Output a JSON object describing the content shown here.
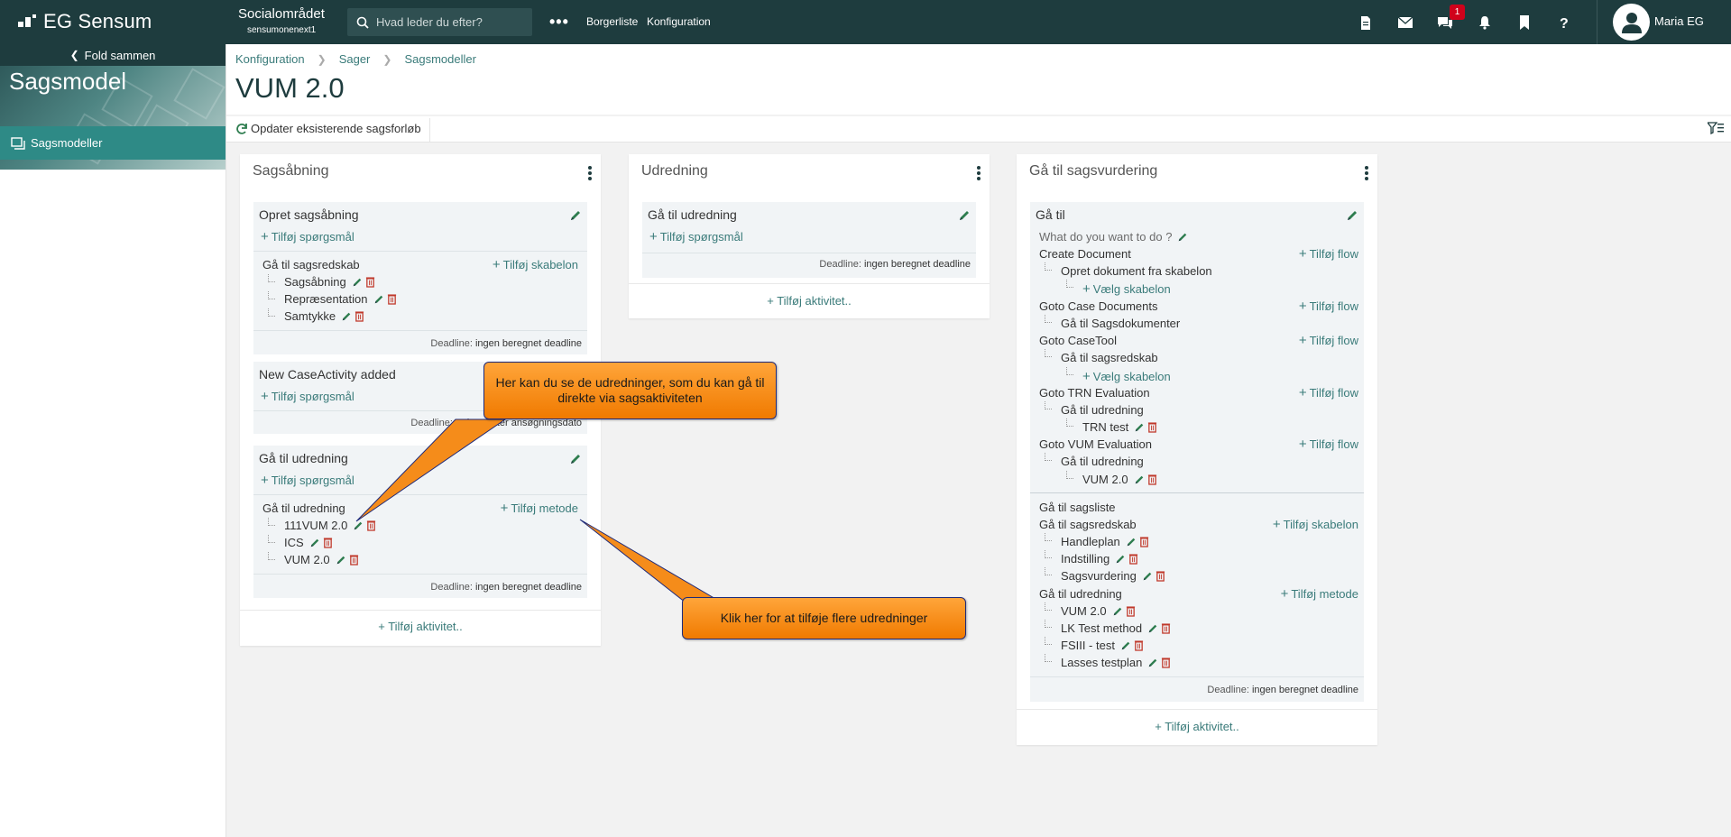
{
  "topbar": {
    "logo": "EG Sensum",
    "org_name": "Socialområdet",
    "org_sub": "sensumonenext1",
    "search_placeholder": "Hvad leder du efter?",
    "more": "•••",
    "link1": "Borgerliste",
    "link2": "Konfiguration",
    "notification_count": "1",
    "user_name": "Maria EG"
  },
  "sidebar": {
    "fold_label": "Fold sammen",
    "title": "Sagsmodel",
    "item": "Sagsmodeller"
  },
  "breadcrumb": [
    "Konfiguration",
    "Sager",
    "Sagsmodeller"
  ],
  "page_title": "VUM 2.0",
  "toolbar": {
    "update_label": "Opdater eksisterende sagsforløb"
  },
  "columns": [
    {
      "title": "Sagsåbning",
      "cards": [
        {
          "title": "Opret sagsåbning",
          "add_question": "Tilføj spørgsmål",
          "group_title": "Gå til sagsredskab",
          "group_add": "Tilføj skabelon",
          "items": [
            "Sagsåbning",
            "Repræsentation",
            "Samtykke"
          ],
          "deadline_label": "Deadline:",
          "deadline_value": "ingen beregnet deadline"
        },
        {
          "title": "New CaseActivity added",
          "add_question": "Tilføj spørgsmål",
          "deadline_label": "Deadline:",
          "deadline_value": "4 dage efter ansøgningsdato"
        },
        {
          "title": "Gå til udredning",
          "add_question": "Tilføj spørgsmål",
          "group_title": "Gå til udredning",
          "group_add": "Tilføj metode",
          "items": [
            "111VUM 2.0",
            "ICS",
            "VUM 2.0"
          ],
          "deadline_label": "Deadline:",
          "deadline_value": "ingen beregnet deadline"
        }
      ],
      "add_activity": "Tilføj aktivitet.."
    },
    {
      "title": "Udredning",
      "cards": [
        {
          "title": "Gå til udredning",
          "add_question": "Tilføj spørgsmål",
          "deadline_label": "Deadline:",
          "deadline_value": "ingen beregnet deadline"
        }
      ],
      "add_activity": "Tilføj aktivitet.."
    },
    {
      "title": "Gå til sagsvurdering",
      "card": {
        "title": "Gå til",
        "question": "What do you want to do ?",
        "flows": [
          {
            "title": "Create Document",
            "add": "Tilføj flow",
            "sub": "Opret dokument fra skabelon",
            "subsub": "Vælg skabelon"
          },
          {
            "title": "Goto Case Documents",
            "add": "Tilføj flow",
            "sub": "Gå til Sagsdokumenter"
          },
          {
            "title": "Goto CaseTool",
            "add": "Tilføj flow",
            "sub": "Gå til sagsredskab",
            "subsub": "Vælg skabelon"
          },
          {
            "title": "Goto TRN Evaluation",
            "add": "Tilføj flow",
            "sub": "Gå til udredning",
            "subsub": "TRN test"
          },
          {
            "title": "Goto VUM Evaluation",
            "add": "Tilføj flow",
            "sub": "Gå til udredning",
            "subsub": "VUM 2.0"
          }
        ],
        "list_title": "Gå til sagsliste",
        "group1_title": "Gå til sagsredskab",
        "group1_add": "Tilføj skabelon",
        "group1_items": [
          "Handleplan",
          "Indstilling",
          "Sagsvurdering"
        ],
        "group2_title": "Gå til udredning",
        "group2_add": "Tilføj metode",
        "group2_items": [
          "VUM 2.0",
          "LK Test method",
          "FSIII - test",
          "Lasses testplan"
        ],
        "deadline_label": "Deadline:",
        "deadline_value": "ingen beregnet deadline"
      },
      "add_activity": "Tilføj aktivitet.."
    }
  ],
  "callouts": {
    "one": "Her kan du se de udredninger, som du kan gå til direkte via sagsaktiviteten",
    "two": "Klik her for at tilføje flere udredninger"
  },
  "colors": {
    "topbar": "#1e3c3e",
    "accent": "#2e8a86",
    "link": "#3a7b7a",
    "callout": "#f58c1a"
  }
}
